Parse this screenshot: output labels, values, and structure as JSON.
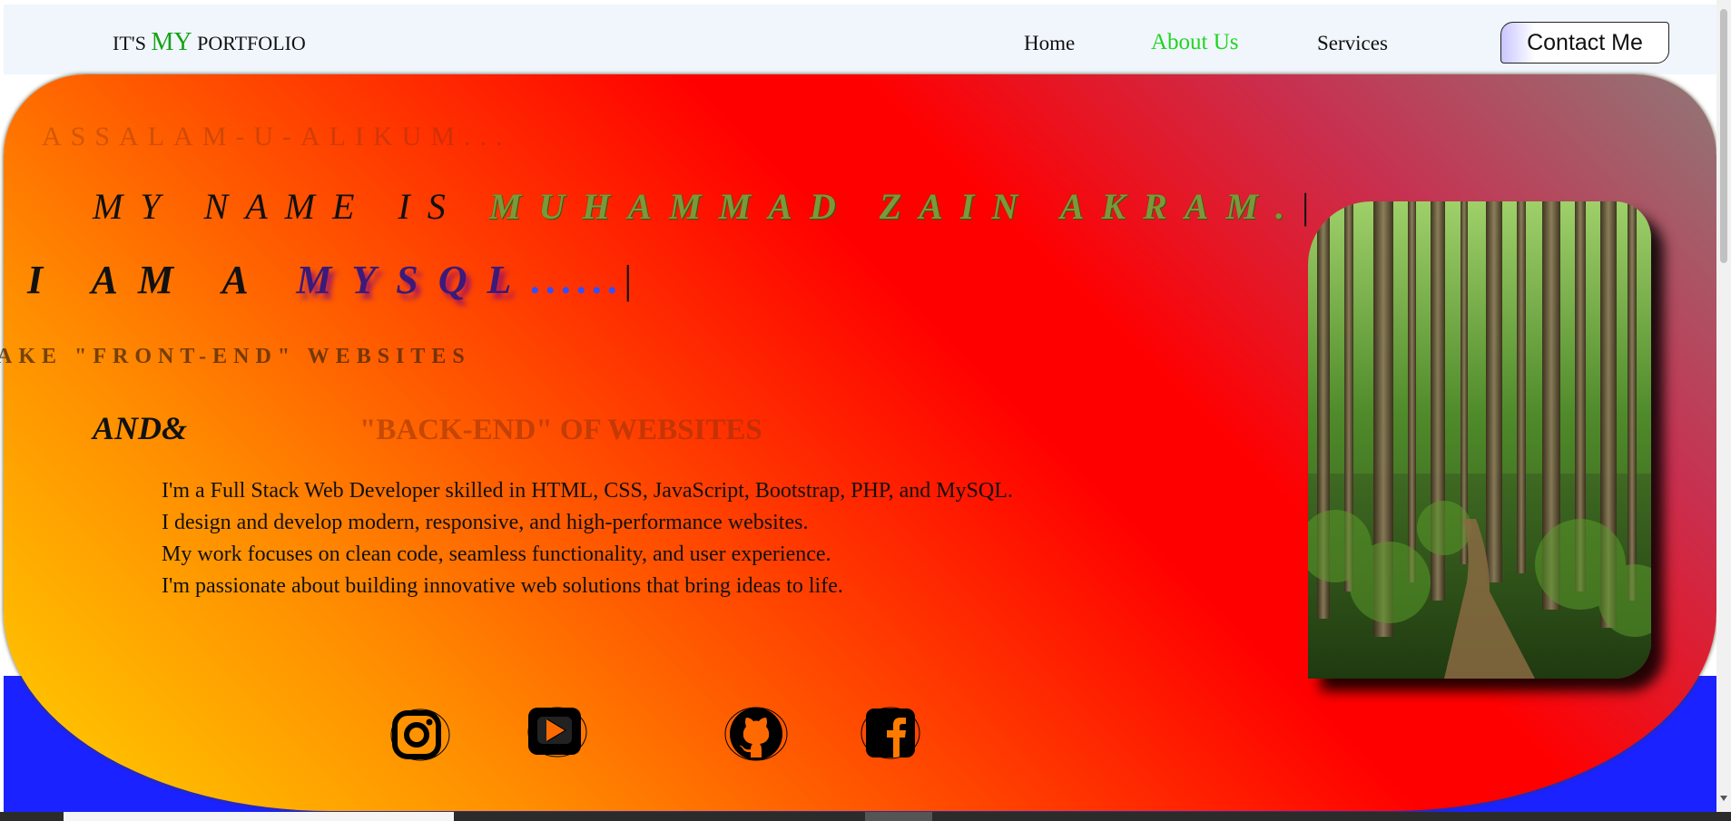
{
  "navbar": {
    "brand_prefix": "IT'S",
    "brand_highlight": "MY",
    "brand_suffix": "PORTFOLIO",
    "links": [
      {
        "label": "Home"
      },
      {
        "label": "About Us"
      },
      {
        "label": "Services"
      }
    ],
    "active_link": "About Us",
    "contact_button": "Contact Me"
  },
  "hero": {
    "greeting": "ASSALAM-U-ALIKUM...",
    "name_prefix": "MY NAME IS",
    "name": "MUHAMMAD ZAIN AKRAM.",
    "cursor": "|",
    "role_prefix": "I AM A",
    "role_tech": "MYSQL",
    "role_dots": "......",
    "front_end": "AKE \"FRONT-END\" WEBSITES",
    "and_text": "AND&",
    "back_end": "\"BACK-END\" OF WEBSITES",
    "bio": [
      "I'm a Full Stack Web Developer skilled in HTML, CSS, JavaScript, Bootstrap, PHP, and MySQL.",
      "I design and develop modern, responsive, and high-performance websites.",
      "My work focuses on clean code, seamless functionality, and user experience.",
      "I'm passionate about building innovative web solutions that bring ideas to life."
    ],
    "photo_alt": "forest-path-photo"
  },
  "social": [
    {
      "icon": "instagram-icon"
    },
    {
      "icon": "youtube-icon"
    },
    {
      "icon": "github-icon"
    },
    {
      "icon": "facebook-icon"
    }
  ],
  "colors": {
    "navbar_bg": "#f0f6fc",
    "brand_accent": "#16a316",
    "active_link": "#21d421",
    "gradient_start": "#ffd000",
    "gradient_mid": "#ff0000",
    "gradient_end": "#8f7878",
    "bottom_strip": "#1a22ff"
  }
}
